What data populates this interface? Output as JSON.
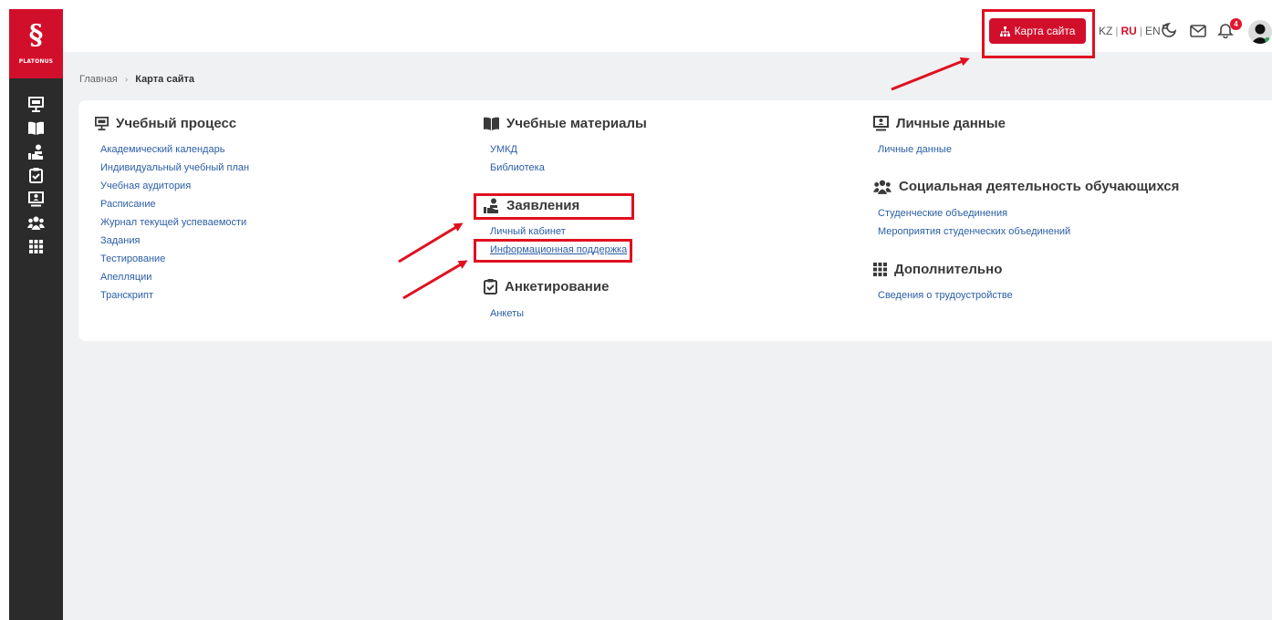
{
  "sidebar": {
    "logo_glyph": "§",
    "logo_text": "PLATONUS",
    "icons": [
      "presentation-icon",
      "book-icon",
      "hand-user-icon",
      "clipboard-check-icon",
      "monitor-user-icon",
      "users-icon",
      "grid-icon"
    ]
  },
  "header": {
    "site_map_button": "Карта сайта",
    "languages": [
      "KZ",
      "RU",
      "EN"
    ],
    "active_language": "RU",
    "notification_count": "4"
  },
  "breadcrumb": {
    "home": "Главная",
    "current": "Карта сайта"
  },
  "sections": {
    "learning_process": {
      "title": "Учебный процесс",
      "links": [
        "Академический календарь",
        "Индивидуальный учебный план",
        "Учебная аудитория",
        "Расписание",
        "Журнал текущей успеваемости",
        "Задания",
        "Тестирование",
        "Апелляции",
        "Транскрипт"
      ]
    },
    "materials": {
      "title": "Учебные материалы",
      "links": [
        "УМКД",
        "Библиотека"
      ]
    },
    "applications": {
      "title": "Заявления",
      "links": [
        "Личный кабинет",
        "Информационная поддержка"
      ]
    },
    "surveys": {
      "title": "Анкетирование",
      "links": [
        "Анкеты"
      ]
    },
    "personal": {
      "title": "Личные данные",
      "links": [
        "Личные данные"
      ]
    },
    "social": {
      "title": "Социальная деятельность обучающихся",
      "links": [
        "Студенческие объединения",
        "Мероприятия студенческих объединений"
      ]
    },
    "additional": {
      "title": "Дополнительно",
      "links": [
        "Сведения о трудоустройстве"
      ]
    }
  },
  "colors": {
    "brand": "#d20f2b",
    "link": "#2b5ea7",
    "sidebar": "#2b2b2b",
    "highlight": "#e0101f"
  }
}
